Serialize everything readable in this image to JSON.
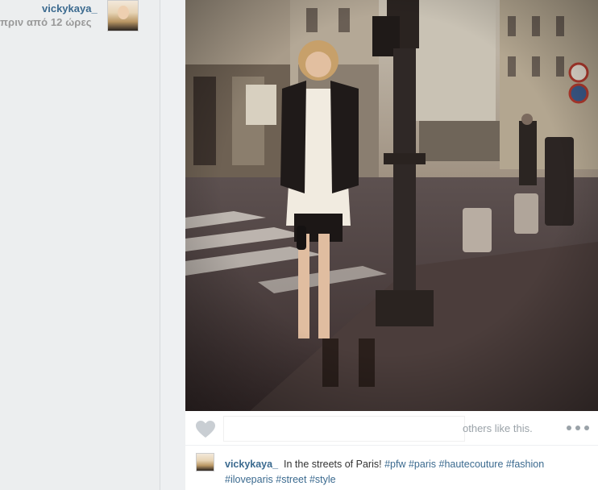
{
  "sidebar": {
    "username": "vickykaya_",
    "timestamp": "πριν από 12 ώρες",
    "avatar_icon": "profile-avatar"
  },
  "post": {
    "likes_text": "others like this.",
    "heart_icon": "heart-icon",
    "more_icon": "more-icon",
    "caption": {
      "username": "vickykaya_",
      "text_before_tags": "In the streets of Paris!",
      "tags": [
        "#pfw",
        "#paris",
        "#hautecouture",
        "#fashion",
        "#iloveparis",
        "#street",
        "#style"
      ]
    }
  },
  "colors": {
    "link": "#3b6a8f",
    "muted": "#9aa2a8",
    "background": "#eef0f2"
  }
}
